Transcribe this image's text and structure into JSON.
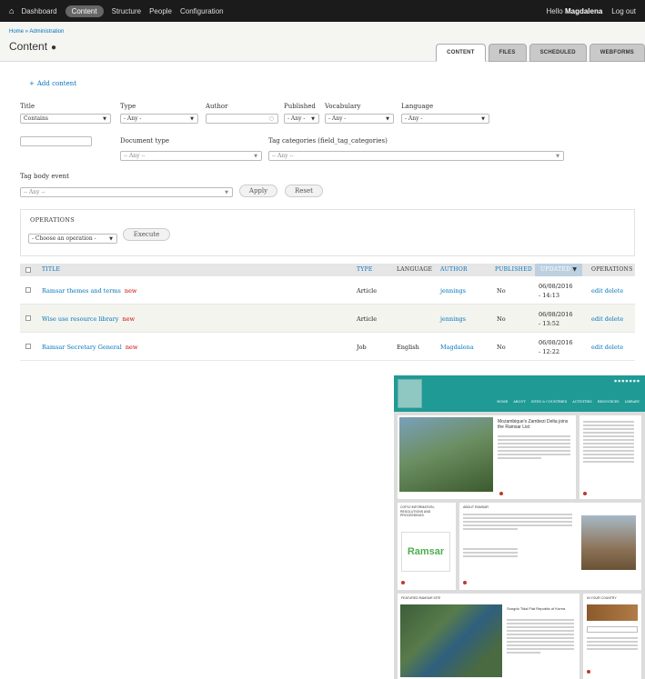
{
  "toolbar": {
    "items": [
      "Dashboard",
      "Content",
      "Structure",
      "People",
      "Configuration"
    ],
    "hello_prefix": "Hello",
    "user": "Magdalena",
    "logout": "Log out"
  },
  "header": {
    "breadcrumb": "Home » Administration",
    "title": "Content",
    "tabs": [
      "CONTENT",
      "FILES",
      "SCHEDULED",
      "WEBFORMS"
    ]
  },
  "add_content": "Add content",
  "filters": {
    "title_label": "Title",
    "title_op": "Contains",
    "type_label": "Type",
    "type_value": "- Any -",
    "author_label": "Author",
    "published_label": "Published",
    "published_value": "- Any -",
    "vocabulary_label": "Vocabulary",
    "vocabulary_value": "- Any -",
    "language_label": "Language",
    "language_value": "- Any -",
    "document_type_label": "Document type",
    "document_type_value": "-- Any --",
    "tag_categories_label": "Tag categories (field_tag_categories)",
    "tag_categories_value": "-- Any --",
    "tag_body_label": "Tag body event",
    "tag_body_value": "-- Any --",
    "apply": "Apply",
    "reset": "Reset"
  },
  "operations": {
    "title": "OPERATIONS",
    "select_value": "- Choose an operation -",
    "execute": "Execute"
  },
  "table": {
    "headers": {
      "title": "TITLE",
      "type": "TYPE",
      "language": "LANGUAGE",
      "author": "AUTHOR",
      "published": "PUBLISHED",
      "updated": "UPDATED",
      "operations": "OPERATIONS"
    },
    "rows": [
      {
        "title": "Ramsar themes and terms",
        "flag": "new",
        "type": "Article",
        "language": "",
        "author": "jennings",
        "published": "No",
        "updated_date": "06/08/2016",
        "updated_time": "- 14:13",
        "edit": "edit",
        "delete": "delete"
      },
      {
        "title": "Wise use resource library",
        "flag": "new",
        "type": "Article",
        "language": "",
        "author": "jennings",
        "published": "No",
        "updated_date": "06/08/2016",
        "updated_time": "- 13:52",
        "edit": "edit",
        "delete": "delete"
      },
      {
        "title": "Ramsar Secretary General",
        "flag": "new",
        "type": "Job",
        "language": "English",
        "author": "Magdalena",
        "published": "No",
        "updated_date": "06/08/2016",
        "updated_time": "- 12:22",
        "edit": "edit",
        "delete": "delete"
      }
    ]
  },
  "site_preview": {
    "nav": [
      "HOME",
      "ABOUT",
      "SITES & COUNTRIES",
      "ACTIVITIES",
      "RESOURCES",
      "LIBRARY"
    ],
    "hero_title": "Mozambique's Zambezi Delta joins the Ramsar List",
    "cop_title": "COP12 INFORMATION, RESOLUTIONS AND PROCEEDINGS",
    "about_title": "ABOUT RAMSAR",
    "featured_title": "FEATURED RAMSAR SITE",
    "featured_site_name": "Songdo Tidal Flat Republic of Korea",
    "country_title": "IN YOUR COUNTRY",
    "logo_text": "Ramsar",
    "colors": {
      "teal": "#1f9a95",
      "red": "#c0392b"
    }
  }
}
